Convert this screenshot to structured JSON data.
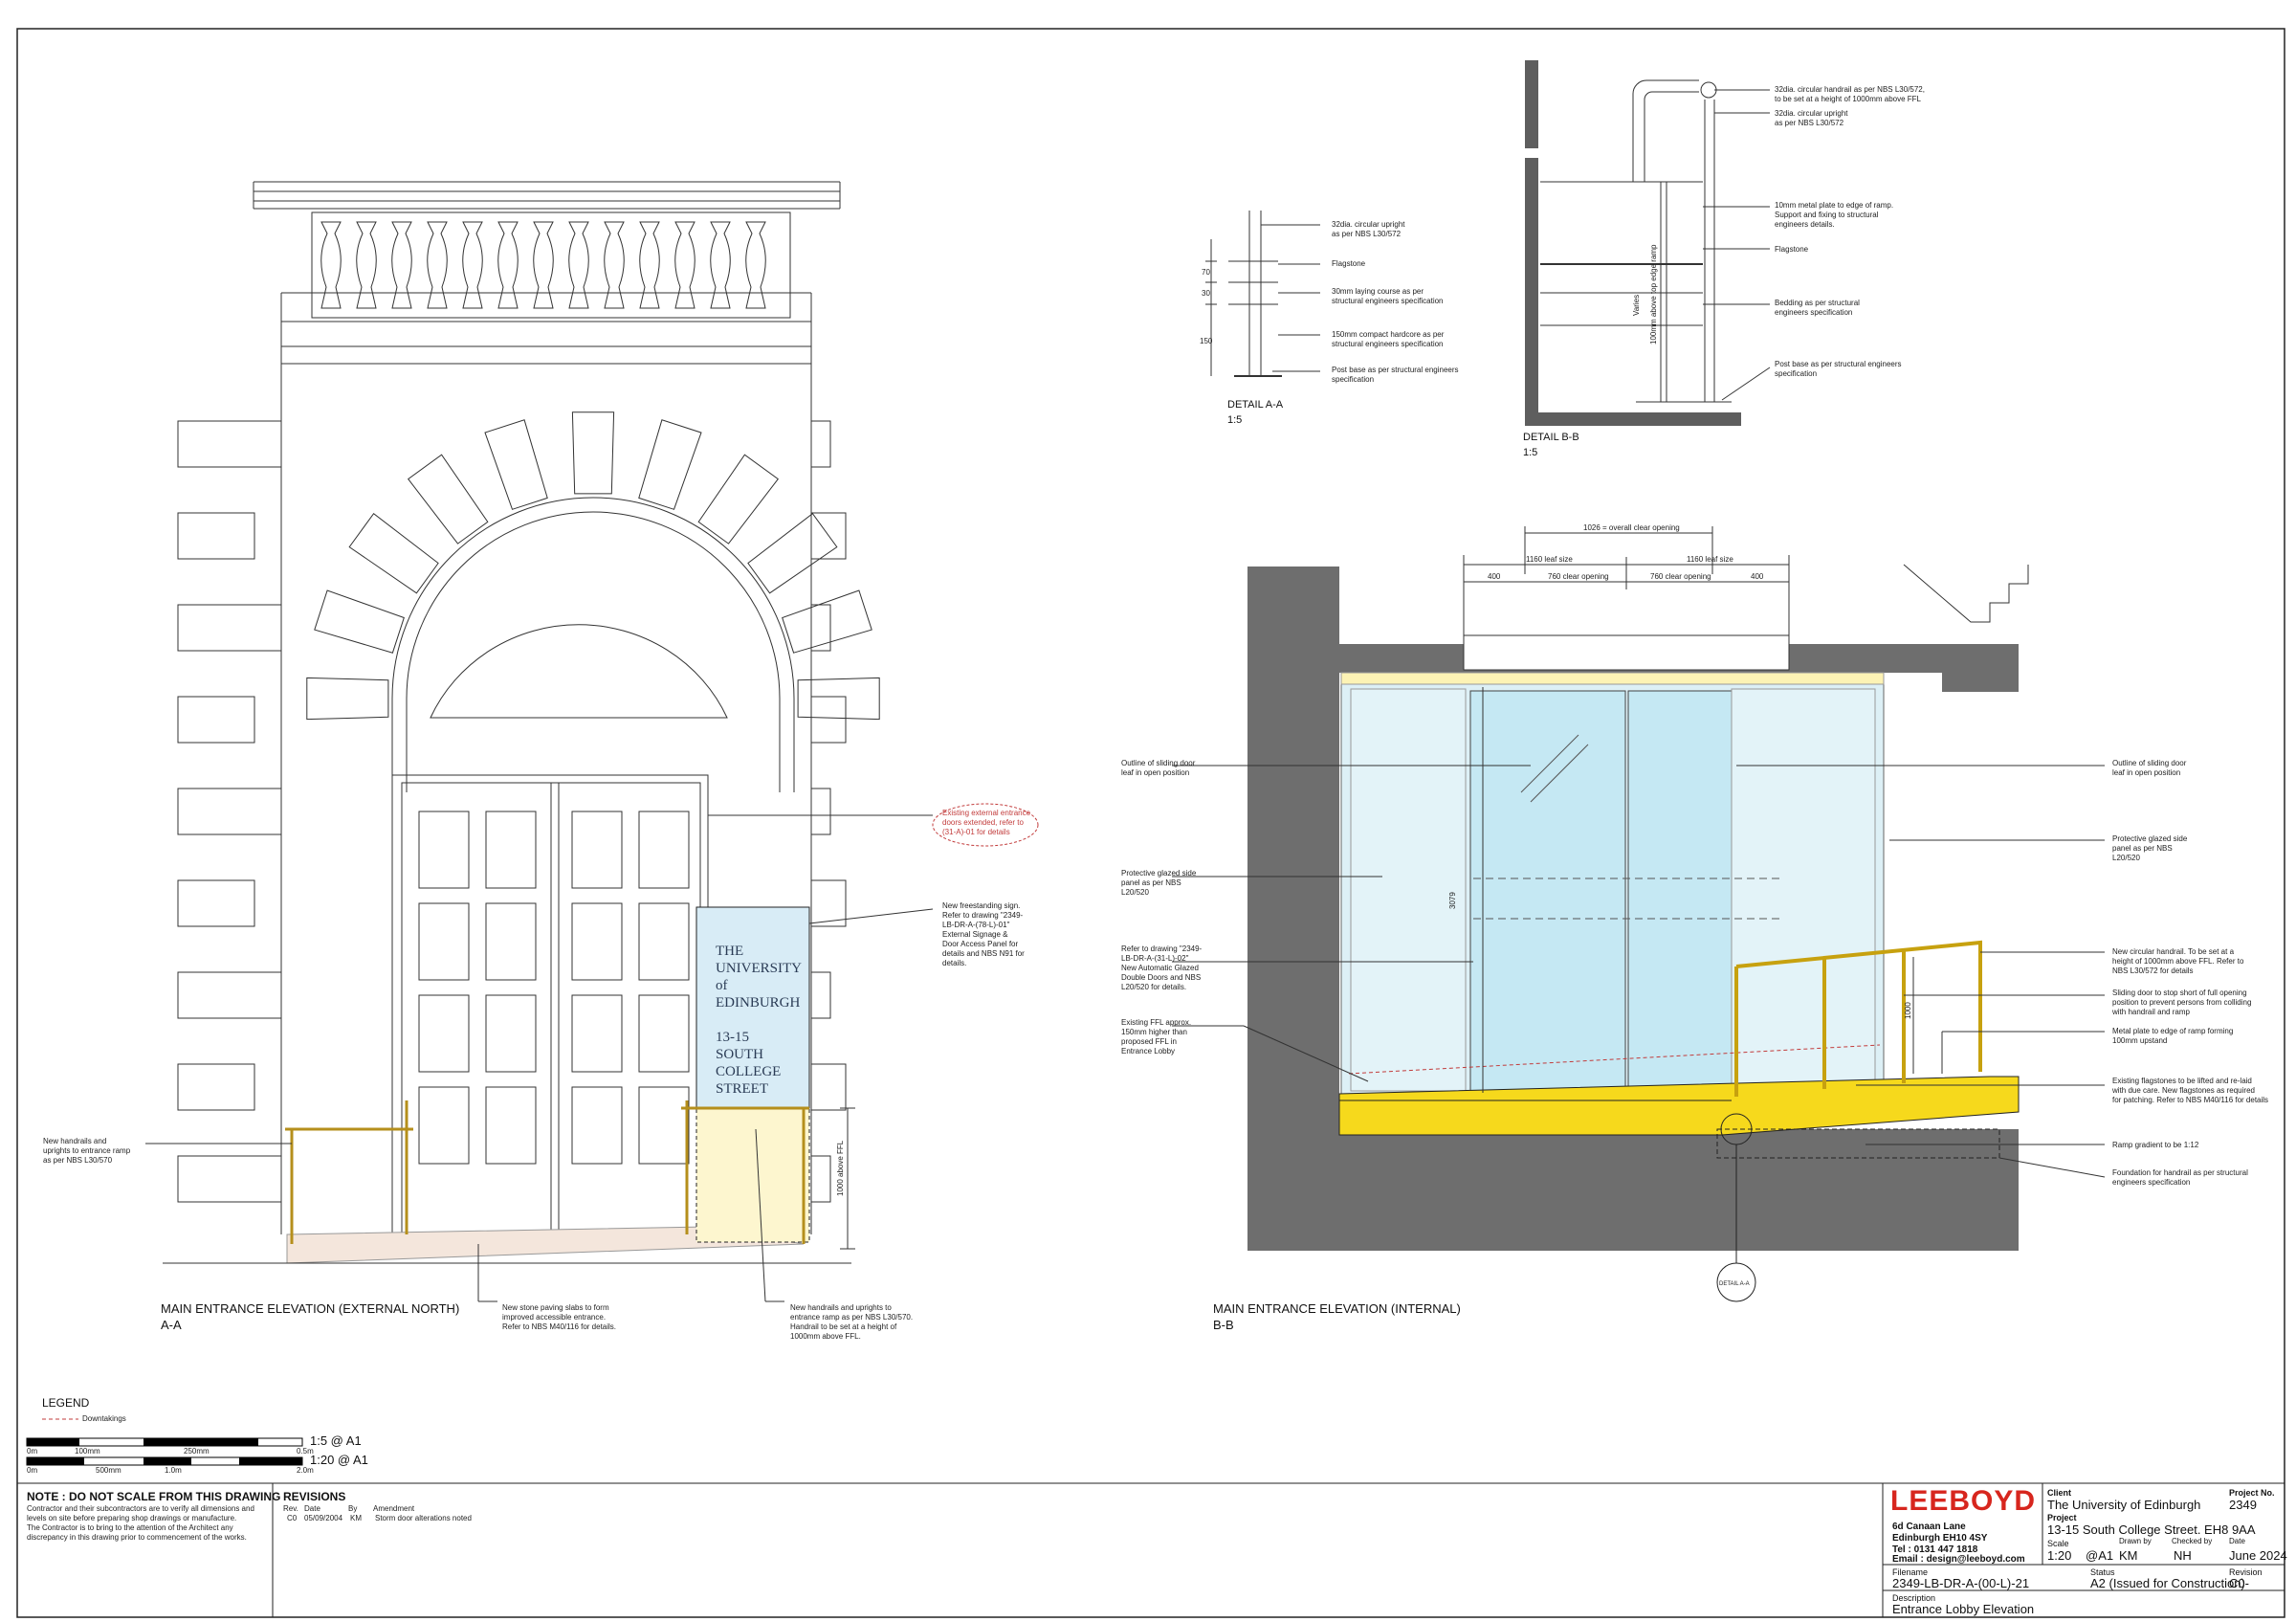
{
  "elevation_external": {
    "title": "MAIN ENTRANCE ELEVATION (EXTERNAL NORTH)",
    "ref": "A-A",
    "notes": {
      "handrails_left": "New handrails and\nuprights to entrance ramp\nas per NBS L30/570",
      "existing_doors": "Existing external entrance\ndoors extended, refer to\n(31-A)-01 for details",
      "sign": "New freestanding sign.\nRefer to drawing \"2349-\nLB-DR-A-(78-L)-01\"\nExternal Signage &\nDoor Access Panel for\ndetails and NBS N91 for\ndetails.",
      "paving": "New stone paving slabs to form\nimproved accessible entrance.\nRefer to NBS M40/116 for details.",
      "handrails_bottom": "New handrails and uprights to\nentrance ramp as per NBS L30/570.\nHandrail to be set at a height of\n1000mm above FFL."
    },
    "dim_1000": "1000 above FFL",
    "sign_lines": [
      "THE",
      "UNIVERSITY",
      "of",
      "EDINBURGH",
      "",
      "13-15",
      "SOUTH",
      "COLLEGE",
      "STREET"
    ]
  },
  "detail_aa": {
    "title": "DETAIL A-A",
    "scale": "1:5",
    "dims": [
      "70",
      "30",
      "150"
    ],
    "notes": [
      "32dia. circular upright\nas per NBS L30/572",
      "Flagstone",
      "30mm laying course as per\nstructural engineers specification",
      "150mm compact hardcore as per\nstructural engineers specification",
      "Post base as per structural engineers\nspecification"
    ]
  },
  "detail_bb": {
    "title": "DETAIL B-B",
    "scale": "1:5",
    "vert_labels": [
      "Varies",
      "100mm above top edge ramp"
    ],
    "notes": [
      "32dia. circular handrail as per NBS L30/572,\nto be set at a height of 1000mm above FFL",
      "32dia. circular upright\nas per NBS L30/572",
      "10mm metal plate to edge of ramp.\nSupport and fixing to structural\nengineers details.",
      "Flagstone",
      "Bedding as per structural\nengineers specification",
      "Post base as per structural engineers\nspecification"
    ]
  },
  "elevation_internal": {
    "title": "MAIN ENTRANCE ELEVATION (INTERNAL)",
    "ref": "B-B",
    "dims": {
      "overall": "1026 = overall clear opening",
      "leaf_left": "1160 leaf size",
      "leaf_right": "1160 leaf size",
      "d400_left": "400",
      "clear_left": "760 clear opening",
      "clear_right": "760 clear opening",
      "d400_right": "400",
      "height": "3079",
      "handrail": "1000"
    },
    "detail_marker": "DETAIL A-A",
    "notes_left": [
      "Outline of sliding door\nleaf in open position",
      "Protective glazed side\npanel as per NBS\nL20/520",
      "Refer to drawing \"2349-\nLB-DR-A-(31-L)-02\"\nNew Automatic Glazed\nDouble Doors and NBS\nL20/520 for details.",
      "Existing FFL approx.\n150mm higher than\nproposed FFL in\nEntrance Lobby"
    ],
    "notes_right": [
      "Outline of sliding door\nleaf in open position",
      "Protective glazed side\npanel as per NBS\nL20/520",
      "New circular handrail. To be set at a\nheight of 1000mm above FFL. Refer to\nNBS L30/572 for details",
      "Sliding door to stop short of full opening\nposition to prevent persons from colliding\nwith handrail and ramp",
      "Metal plate to edge of ramp forming\n100mm upstand",
      "Existing flagstones to be lifted and re-laid\nwith due care. New flagstones as required\nfor patching. Refer to NBS M40/116 for details",
      "Ramp gradient to be 1:12",
      "Foundation for handrail as per structural\nengineers specification"
    ]
  },
  "legend": {
    "title": "LEGEND",
    "item": "Downtakings",
    "scale1": {
      "label": "1:5 @ A1",
      "ticks": [
        "0m",
        "100mm",
        "250mm",
        "0.5m"
      ]
    },
    "scale2": {
      "label": "1:20 @ A1",
      "ticks": [
        "0m",
        "500mm",
        "1.0m",
        "2.0m"
      ]
    }
  },
  "note_box": {
    "title": "NOTE : DO NOT SCALE FROM THIS DRAWING",
    "body": "Contractor and their subcontractors are to verify all dimensions and\nlevels on site before preparing shop drawings or manufacture.\nThe Contractor is to bring to the attention of the Architect any\ndiscrepancy in this drawing prior to commencement of the works."
  },
  "revisions": {
    "title": "REVISIONS",
    "headers": [
      "Rev.",
      "Date",
      "By",
      "Amendment"
    ],
    "rows": [
      [
        "C0",
        "05/09/2004",
        "KM",
        "Storm door alterations noted"
      ]
    ]
  },
  "title_block": {
    "brand": "LEEBOYD",
    "address": [
      "6d Canaan Lane",
      "Edinburgh EH10 4SY",
      "Tel : 0131 447 1818",
      "Email : design@leeboyd.com"
    ],
    "client_label": "Client",
    "client": "The University of Edinburgh",
    "project_no_label": "Project No.",
    "project_no": "2349",
    "project_label": "Project",
    "project": "13-15 South College Street. EH8 9AA",
    "scale_label": "Scale",
    "scale": "1:20",
    "paper": "@A1",
    "drawn_label": "Drawn by",
    "drawn": "KM",
    "checked_label": "Checked by",
    "checked": "NH",
    "date_label": "Date",
    "date": "June 2024",
    "filename_label": "Filename",
    "filename": "2349-LB-DR-A-(00-L)-21",
    "status_label": "Status",
    "status": "A2 (Issued for Construction)",
    "revision_label": "Revision",
    "revision": "C0-",
    "description_label": "Description",
    "description": "Entrance Lobby Elevation"
  }
}
